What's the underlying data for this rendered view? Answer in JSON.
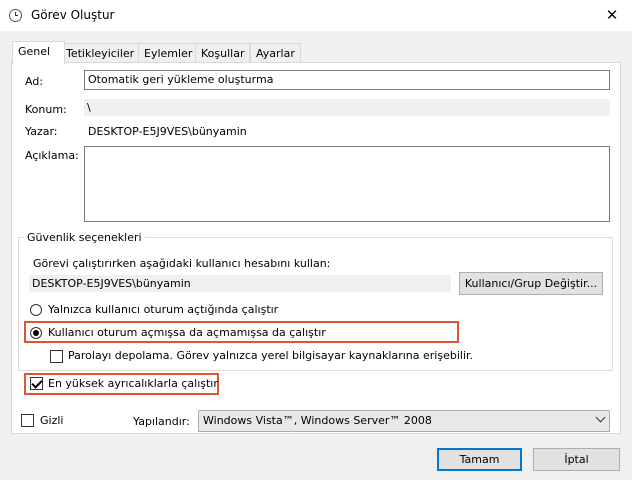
{
  "window": {
    "title": "Görev Oluştur",
    "close_symbol": "✕"
  },
  "tabs": [
    "Genel",
    "Tetikleyiciler",
    "Eylemler",
    "Koşullar",
    "Ayarlar"
  ],
  "general": {
    "name_label": "Ad:",
    "name_value": "Otomatik geri yükleme oluşturma",
    "location_label": "Konum:",
    "location_value": "\\",
    "author_label": "Yazar:",
    "author_value": "DESKTOP-E5J9VES\\bünyamin",
    "description_label": "Açıklama:",
    "description_value": ""
  },
  "security": {
    "group_title": "Güvenlik seçenekleri",
    "account_prompt": "Görevi çalıştırırken aşağıdaki kullanıcı hesabını kullan:",
    "account_value": "DESKTOP-E5J9VES\\bünyamin",
    "change_user_button": "Kullanıcı/Grup Değiştir...",
    "radio_logged_on": "Yalnızca kullanıcı oturum açtığında çalıştır",
    "radio_whether_logged": "Kullanıcı oturum açmışsa da açmamışsa da çalıştır",
    "do_not_store_password": "Parolayı depolama. Görev yalnızca yerel bilgisayar kaynaklarına erişebilir.",
    "highest_privileges": "En yüksek ayrıcalıklarla çalıştır"
  },
  "hidden_label": "Gizli",
  "configure_label": "Yapılandır:",
  "configure_value": "Windows Vista™, Windows Server™ 2008",
  "buttons": {
    "ok": "Tamam",
    "cancel": "İptal"
  },
  "state": {
    "selected_radio": "radio_whether_logged",
    "do_not_store_password": false,
    "highest_privileges": true,
    "hidden": false
  },
  "colors": {
    "highlight": "#e0552f",
    "primary_border": "#0078d7"
  }
}
